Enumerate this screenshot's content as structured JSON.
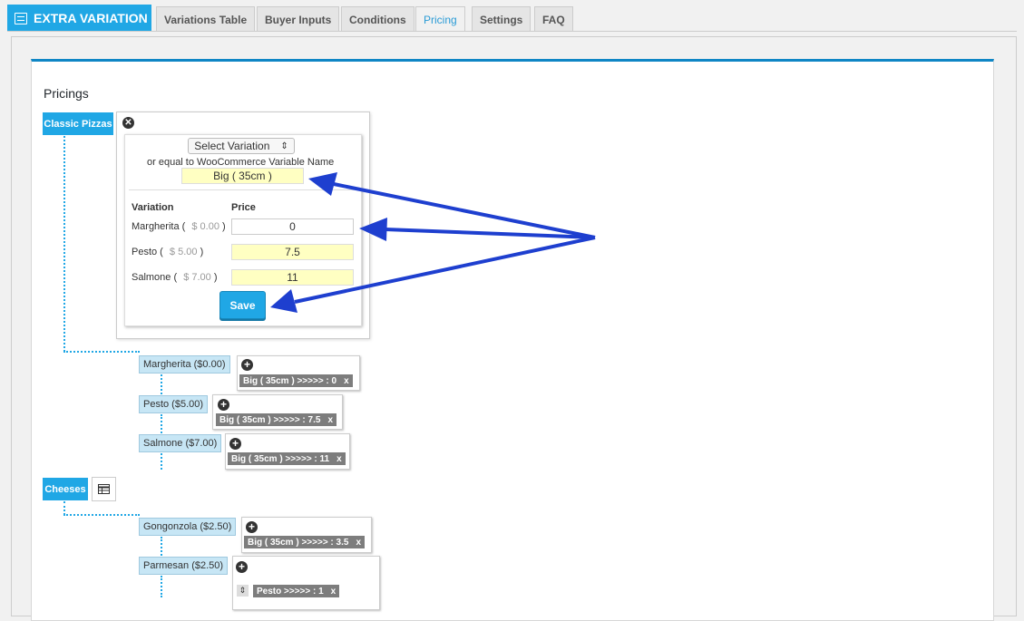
{
  "header": {
    "brand": "EXTRA VARIATION",
    "tabs": [
      "Variations Table",
      "Buyer Inputs",
      "Conditions",
      "Pricing",
      "Settings",
      "FAQ"
    ],
    "active_tab": "Pricing"
  },
  "section_title": "Pricings",
  "editor": {
    "select_label": "Select Variation",
    "select_arrow": "⇕",
    "equal_text": "or equal to WooCommerce Variable Name",
    "variable_name": "Big ( 35cm )",
    "col_variation": "Variation",
    "col_price": "Price",
    "rows": [
      {
        "name": "Margherita (",
        "base": "$ 0.00",
        "close": ")",
        "price": "0"
      },
      {
        "name": "Pesto (",
        "base": "$ 5.00",
        "close": ")",
        "price": "7.5"
      },
      {
        "name": "Salmone (",
        "base": "$ 7.00",
        "close": ")",
        "price": "11"
      }
    ],
    "save_label": "Save"
  },
  "categories": [
    {
      "name": "Classic Pizzas",
      "items": [
        {
          "label": "Margherita ($0.00)",
          "chips": [
            {
              "text": "Big ( 35cm ) >>>>> : 0",
              "close": "x"
            }
          ]
        },
        {
          "label": "Pesto ($5.00)",
          "chips": [
            {
              "text": "Big ( 35cm ) >>>>> : 7.5",
              "close": "x"
            }
          ]
        },
        {
          "label": "Salmone ($7.00)",
          "chips": [
            {
              "text": "Big ( 35cm ) >>>>> : 11",
              "close": "x"
            }
          ]
        }
      ]
    },
    {
      "name": "Cheeses",
      "items": [
        {
          "label": "Gongonzola ($2.50)",
          "chips": [
            {
              "text": "Big ( 35cm ) >>>>> : 3.5",
              "close": "x"
            }
          ]
        },
        {
          "label": "Parmesan ($2.50)",
          "chips": [
            {
              "text": "Pesto >>>>> : 1",
              "close": "x"
            }
          ]
        }
      ]
    }
  ],
  "icons": {
    "plus": "+",
    "close": "✕",
    "sort": "⇕"
  },
  "colors": {
    "accent": "#20a7e5",
    "arrow": "#1e3fcf",
    "highlight": "#ffffc2",
    "chip": "#7d7d7d"
  }
}
